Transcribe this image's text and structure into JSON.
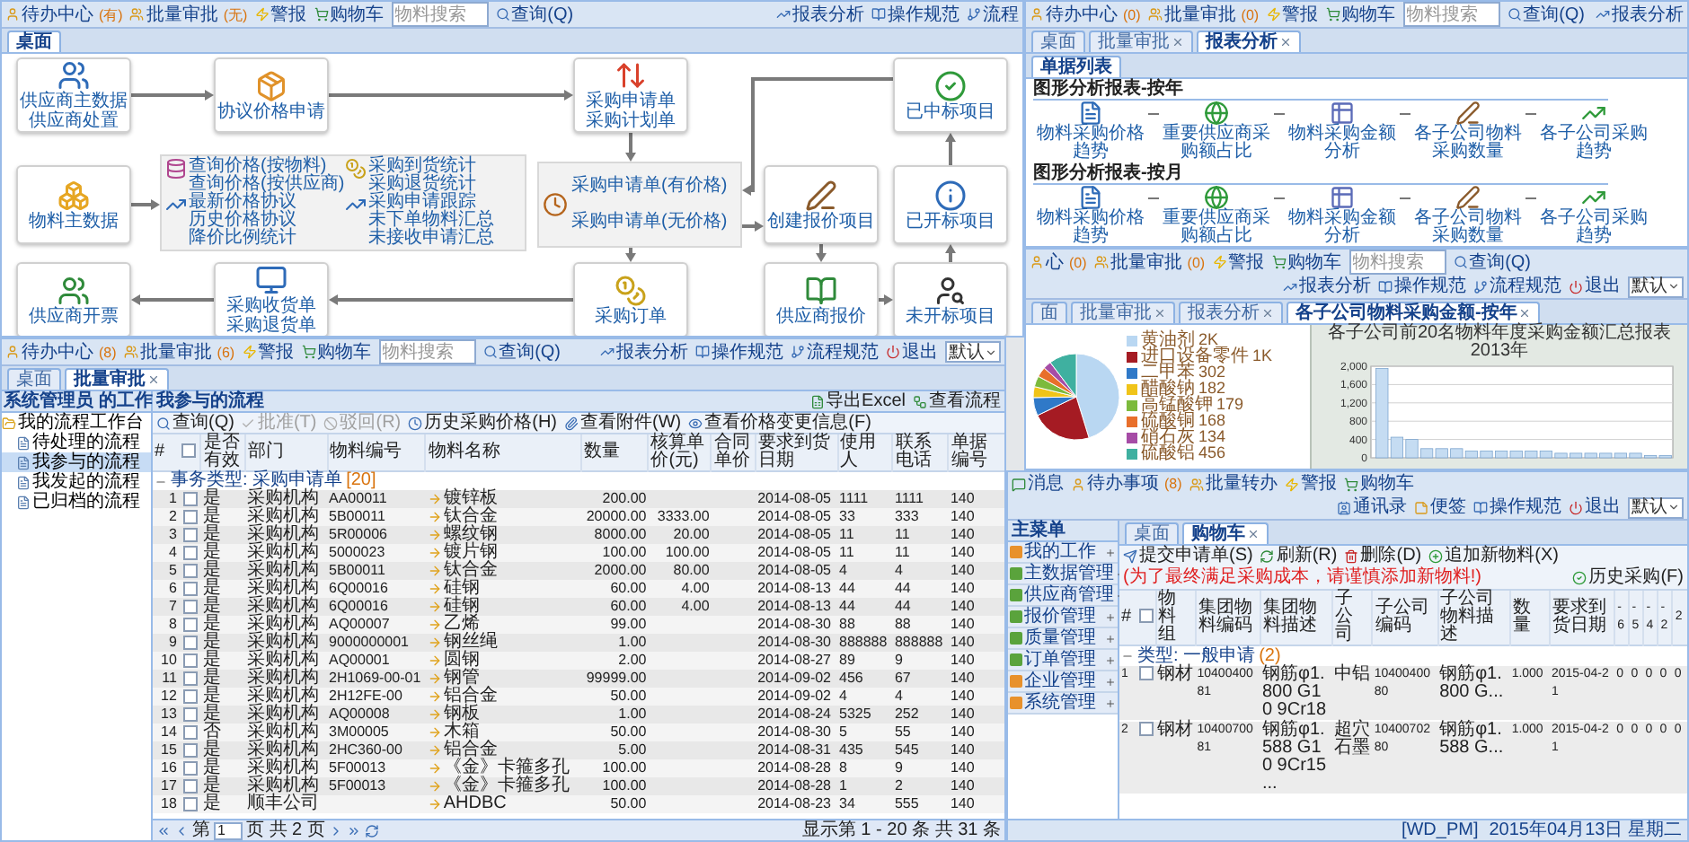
{
  "flow_window": {
    "toolbar": {
      "items": [
        {
          "label": "待办中心",
          "count": "(有)"
        },
        {
          "label": "批量审批",
          "count": "(无)"
        },
        {
          "label": "警报"
        },
        {
          "label": "购物车"
        }
      ],
      "search": {
        "placeholder": "物料搜索"
      },
      "query": "查询(Q)",
      "right": [
        {
          "label": "报表分析"
        },
        {
          "label": "操作规范"
        },
        {
          "label": "流程"
        }
      ]
    },
    "tabs": [
      {
        "label": "桌面",
        "selected": true
      }
    ],
    "nodes": [
      {
        "lines": [
          "供应商主数据",
          "供应商处置"
        ]
      },
      {
        "lines": [
          "协议价格申请"
        ]
      },
      {
        "lines": [
          "采购申请单",
          "采购计划单"
        ]
      },
      {
        "lines": [
          "已中标项目"
        ]
      },
      {
        "lines": [
          "物料主数据"
        ]
      },
      {
        "lines": [
          "创建报价项目"
        ]
      },
      {
        "lines": [
          "已开标项目"
        ]
      },
      {
        "lines": [
          "供应商开票"
        ]
      },
      {
        "lines": [
          "采购收货单",
          "采购退货单"
        ]
      },
      {
        "lines": [
          "采购订单"
        ]
      },
      {
        "lines": [
          "供应商报价"
        ]
      },
      {
        "lines": [
          "未开标项目"
        ]
      }
    ],
    "query_panel": {
      "groups": [
        {
          "links": [
            "查询价格(按物料)",
            "查询价格(按供应商)"
          ]
        },
        {
          "links": [
            "采购到货统计",
            "采购退货统计"
          ]
        },
        {
          "links": [
            "最新价格协议",
            "历史价格协议",
            "降价比例统计"
          ]
        },
        {
          "links": [
            "采购申请跟踪",
            "未下单物料汇总",
            "未接收申请汇总"
          ]
        }
      ]
    },
    "request_panel": {
      "links": [
        "采购申请单(有价格)",
        "采购申请单(无价格)"
      ]
    }
  },
  "report_window": {
    "toolbar": {
      "items": [
        {
          "label": "待办中心",
          "count": "(0)"
        },
        {
          "label": "批量审批",
          "count": "(0)"
        },
        {
          "label": "警报"
        },
        {
          "label": "购物车"
        }
      ],
      "search": {
        "placeholder": "物料搜索"
      },
      "query": "查询(Q)",
      "right": [
        {
          "label": "报表分析"
        }
      ]
    },
    "tabs": [
      {
        "label": "桌面",
        "selected": false,
        "closable": false
      },
      {
        "label": "批量审批",
        "selected": false,
        "closable": true
      },
      {
        "label": "报表分析",
        "selected": true,
        "closable": true
      }
    ],
    "subtabs": [
      {
        "label": "单据列表",
        "selected": true
      }
    ],
    "sections": [
      {
        "title": "图形分析报表-按年",
        "items": [
          "物料采购价格趋势",
          "重要供应商采购额占比",
          "物料采购金额分析",
          "各子公司物料采购数量",
          "各子公司采购趋势"
        ]
      },
      {
        "title": "图形分析报表-按月",
        "items": [
          "物料采购价格趋势",
          "重要供应商采购额占比",
          "物料采购金额分析",
          "各子公司物料采购数量",
          "各子公司采购趋势"
        ]
      }
    ]
  },
  "chart_window": {
    "toolbar": {
      "items": [
        {
          "label": "心",
          "count": "(0)"
        },
        {
          "label": "批量审批",
          "count": "(0)"
        },
        {
          "label": "警报"
        },
        {
          "label": "购物车"
        }
      ],
      "search": {
        "placeholder": "物料搜索"
      },
      "query": "查询(Q)",
      "right": [
        {
          "label": "报表分析"
        },
        {
          "label": "操作规范"
        },
        {
          "label": "流程规范"
        },
        {
          "label": "退出"
        }
      ],
      "user": "默认"
    },
    "tabs": [
      {
        "label": "面",
        "selected": false,
        "closable": false
      },
      {
        "label": "批量审批",
        "selected": false,
        "closable": true
      },
      {
        "label": "报表分析",
        "selected": false,
        "closable": true
      },
      {
        "label": "各子公司物料采购金额-按年",
        "selected": true,
        "closable": true
      }
    ],
    "pie": {
      "chart_data": {
        "type": "pie",
        "categories": [
          "黄油剂",
          "进口设备零件",
          "二甲苯",
          "醋酸钠",
          "高锰酸钾",
          "硫酸铜",
          "硝石灰",
          "硫酸铝"
        ],
        "values": [
          2000,
          1000,
          302,
          182,
          179,
          168,
          134,
          456
        ],
        "value_labels": [
          "2K",
          "1K",
          "302",
          "182",
          "179",
          "168",
          "134",
          "456"
        ],
        "data_labels": true,
        "legend": "right"
      }
    },
    "bar": {
      "chart_data": {
        "type": "bar",
        "title": "各子公司前20名物料年度采购金额汇总报表",
        "subtitle": "2013年",
        "values": [
          1950,
          450,
          400,
          200,
          200,
          200,
          150,
          150,
          150,
          150,
          150,
          150,
          100,
          100,
          100,
          100,
          100,
          100,
          50,
          50
        ],
        "grid": true,
        "ylim": [
          0,
          2000
        ],
        "yticks": [
          0,
          400,
          800,
          {
            "value": 1200,
            "label": "1,200"
          },
          {
            "value": 1600,
            "label": "1,600"
          },
          {
            "value": 2000,
            "label": "2,000"
          }
        ]
      }
    }
  },
  "process_window": {
    "toolbar": {
      "items": [
        {
          "label": "待办中心",
          "count": "(8)"
        },
        {
          "label": "批量审批",
          "count": "(6)"
        },
        {
          "label": "警报"
        },
        {
          "label": "购物车"
        }
      ],
      "search": {
        "placeholder": "物料搜索"
      },
      "query": "查询(Q)",
      "right": [
        {
          "label": "报表分析"
        },
        {
          "label": "操作规范"
        },
        {
          "label": "流程规范"
        },
        {
          "label": "退出"
        }
      ],
      "user": "默认"
    },
    "tabs": [
      {
        "label": "桌面",
        "selected": false,
        "closable": false
      },
      {
        "label": "批量审批",
        "selected": true,
        "closable": true
      }
    ],
    "tree": {
      "title": "系统管理员 的工作",
      "items": [
        {
          "label": "我的流程工作台",
          "expanded": true,
          "selected": false,
          "children": [
            {
              "label": "待处理的流程",
              "selected": false
            },
            {
              "label": "我参与的流程",
              "selected": true
            },
            {
              "label": "我发起的流程",
              "selected": false
            },
            {
              "label": "已归档的流程",
              "selected": false
            }
          ]
        }
      ]
    },
    "panel_title": "我参与的流程",
    "actions": [
      {
        "label": "查询(Q)",
        "disabled": false
      },
      {
        "label": "批准(T)",
        "disabled": true
      },
      {
        "label": "驳回(R)",
        "disabled": true
      },
      {
        "label": "历史采购价格(H)",
        "disabled": false
      },
      {
        "label": "查看附件(W)",
        "disabled": false
      },
      {
        "label": "查看价格变更信息(F)",
        "disabled": false
      }
    ],
    "right_actions": [
      {
        "label": "导出Excel"
      },
      {
        "label": "查看流程"
      }
    ],
    "table": {
      "columns": [
        "#",
        "是否有效",
        "部门",
        "物料编号",
        "物料名称",
        "数量",
        "核算单价(元)",
        "合同单价",
        "要求到货日期",
        "使用人",
        "联系电话",
        "单据编号"
      ],
      "header_checked": false,
      "group": {
        "label": "事务类型: 采购申请单",
        "count": "[20]"
      },
      "rows": [
        {
          "checked": false,
          "n": "1",
          "valid": "是",
          "dept": "采购机构",
          "code": "AA00011",
          "name": "镀锌板",
          "qty": "200.00",
          "date": "2014-08-05",
          "user": "1111",
          "phone": "1111",
          "doc": "140"
        },
        {
          "checked": false,
          "n": "2",
          "valid": "是",
          "dept": "采购机构",
          "code": "5B00011",
          "name": "钛合金",
          "qty": "20000.00",
          "price": "3333.00",
          "date": "2014-08-05",
          "user": "33",
          "phone": "333",
          "doc": "140"
        },
        {
          "checked": false,
          "n": "3",
          "valid": "是",
          "dept": "采购机构",
          "code": "5R00006",
          "name": "螺纹钢",
          "qty": "8000.00",
          "price": "20.00",
          "date": "2014-08-05",
          "user": "11",
          "phone": "11",
          "doc": "140"
        },
        {
          "checked": false,
          "n": "4",
          "valid": "是",
          "dept": "采购机构",
          "code": "5000023",
          "name": "镀片钢",
          "qty": "100.00",
          "price": "100.00",
          "date": "2014-08-05",
          "user": "11",
          "phone": "11",
          "doc": "140"
        },
        {
          "checked": false,
          "n": "5",
          "valid": "是",
          "dept": "采购机构",
          "code": "5B00011",
          "name": "钛合金",
          "qty": "2000.00",
          "price": "80.00",
          "date": "2014-08-05",
          "user": "4",
          "phone": "4",
          "doc": "140"
        },
        {
          "checked": false,
          "n": "6",
          "valid": "是",
          "dept": "采购机构",
          "code": "6Q00016",
          "name": "硅钢",
          "qty": "60.00",
          "price": "4.00",
          "date": "2014-08-13",
          "user": "44",
          "phone": "44",
          "doc": "140"
        },
        {
          "checked": false,
          "n": "7",
          "valid": "是",
          "dept": "采购机构",
          "code": "6Q00016",
          "name": "硅钢",
          "qty": "60.00",
          "price": "4.00",
          "date": "2014-08-13",
          "user": "44",
          "phone": "44",
          "doc": "140"
        },
        {
          "checked": false,
          "n": "8",
          "valid": "是",
          "dept": "采购机构",
          "code": "AQ00007",
          "name": "乙烯",
          "qty": "99.00",
          "date": "2014-08-30",
          "user": "88",
          "phone": "88",
          "doc": "140"
        },
        {
          "checked": false,
          "n": "9",
          "valid": "是",
          "dept": "采购机构",
          "code": "9000000001",
          "name": "钢丝绳",
          "qty": "1.00",
          "date": "2014-08-30",
          "user": "888888",
          "phone": "888888",
          "doc": "140"
        },
        {
          "checked": false,
          "n": "10",
          "valid": "是",
          "dept": "采购机构",
          "code": "AQ00001",
          "name": "圆钢",
          "qty": "2.00",
          "date": "2014-08-27",
          "user": "89",
          "phone": "9",
          "doc": "140"
        },
        {
          "checked": false,
          "n": "11",
          "valid": "是",
          "dept": "采购机构",
          "code": "2H1069-00-01",
          "name": "钢管",
          "qty": "99999.00",
          "date": "2014-09-02",
          "user": "456",
          "phone": "67",
          "doc": "140"
        },
        {
          "checked": false,
          "n": "12",
          "valid": "是",
          "dept": "采购机构",
          "code": "2H12FE-00",
          "name": "铝合金",
          "qty": "50.00",
          "date": "2014-09-02",
          "user": "4",
          "phone": "4",
          "doc": "140"
        },
        {
          "checked": false,
          "n": "13",
          "valid": "是",
          "dept": "采购机构",
          "code": "AQ00008",
          "name": "钢板",
          "qty": "1.00",
          "date": "2014-08-24",
          "user": "5325",
          "phone": "252",
          "doc": "140"
        },
        {
          "checked": false,
          "n": "14",
          "valid": "否",
          "dept": "采购机构",
          "code": "3M00005",
          "name": "木箱",
          "qty": "50.00",
          "date": "2014-08-30",
          "user": "5",
          "phone": "55",
          "doc": "140"
        },
        {
          "checked": false,
          "n": "15",
          "valid": "是",
          "dept": "采购机构",
          "code": "2HC360-00",
          "name": "铝合金",
          "qty": "5.00",
          "date": "2014-08-31",
          "user": "435",
          "phone": "545",
          "doc": "140"
        },
        {
          "checked": false,
          "n": "16",
          "valid": "是",
          "dept": "采购机构",
          "code": "5F00013",
          "name": "《金》卡箍多孔",
          "qty": "100.00",
          "date": "2014-08-28",
          "user": "8",
          "phone": "9",
          "doc": "140"
        },
        {
          "checked": false,
          "n": "17",
          "valid": "是",
          "dept": "采购机构",
          "code": "5F00013",
          "name": "《金》卡箍多孔",
          "qty": "100.00",
          "date": "2014-08-28",
          "user": "1",
          "phone": "2",
          "doc": "140"
        },
        {
          "checked": false,
          "n": "18",
          "valid": "是",
          "dept": "顺丰公司",
          "name": "AHDBC",
          "qty": "50.00",
          "date": "2014-08-23",
          "user": "34",
          "phone": "555",
          "doc": "140"
        }
      ]
    },
    "pager": {
      "before": "第",
      "page": "1",
      "after": "页 共 2 页",
      "info": "显示第 1 - 20 条 共 31 条"
    }
  },
  "cart_window": {
    "toolbar": {
      "items": [
        {
          "label": "消息"
        },
        {
          "label": "待办事项",
          "count": "(8)"
        },
        {
          "label": "批量转办"
        },
        {
          "label": "警报"
        },
        {
          "label": "购物车"
        }
      ],
      "right": [
        {
          "label": "通讯录"
        },
        {
          "label": "便签"
        },
        {
          "label": "操作规范"
        },
        {
          "label": "退出"
        }
      ],
      "user": "默认"
    },
    "menu": {
      "title": "主菜单",
      "items": [
        {
          "label": "我的工作",
          "color": "#e8912c"
        },
        {
          "label": "主数据管理",
          "color": "#5aa33c"
        },
        {
          "label": "供应商管理",
          "color": "#5aa33c"
        },
        {
          "label": "报价管理",
          "color": "#5aa33c"
        },
        {
          "label": "质量管理",
          "color": "#5aa33c"
        },
        {
          "label": "订单管理",
          "color": "#5aa33c"
        },
        {
          "label": "企业管理",
          "color": "#e8912c"
        },
        {
          "label": "系统管理",
          "color": "#e8912c"
        }
      ]
    },
    "tabs": [
      {
        "label": "桌面",
        "selected": false,
        "closable": false
      },
      {
        "label": "购物车",
        "selected": true,
        "closable": true
      }
    ],
    "actions": [
      {
        "label": "提交申请单(S)"
      },
      {
        "label": "刷新(R)"
      },
      {
        "label": "删除(D)"
      },
      {
        "label": "追加新物料(X)"
      }
    ],
    "note": "(为了最终满足采购成本，请谨慎添加新物料!)",
    "history": "历史采购(F)",
    "table": {
      "columns": [
        "#",
        "物料组",
        "集团物料编码",
        "集团物料描述",
        "子公司",
        "子公司编码",
        "子公司物料描述",
        "数量",
        "要求到货日期",
        "-6",
        "-5",
        "-4",
        "-2",
        "2"
      ],
      "header_checked": false,
      "group": {
        "label": "类型: 一般申请",
        "count": "(2)"
      },
      "rows": [
        {
          "checked": false,
          "cells": [
            "1",
            "钢材",
            "1040040081",
            "钢筋φ1.800 G10 9Cr18",
            "中铝",
            "1040040080",
            "钢筋φ1.800 G...",
            "1.000",
            "2015-04-21",
            "0",
            "0",
            "0",
            "0",
            "0"
          ]
        },
        {
          "checked": false,
          "cells": [
            "2",
            "钢材",
            "1040070081",
            "钢筋φ1.588 G10 9Cr15 ...",
            "超穴石墨",
            "1040070280",
            "钢筋φ1.588 G...",
            "1.000",
            "2015-04-21",
            "0",
            "0",
            "0",
            "0",
            "0"
          ]
        }
      ]
    },
    "status": [
      "[WD_PM]",
      "2015年04月13日 星期二"
    ]
  }
}
